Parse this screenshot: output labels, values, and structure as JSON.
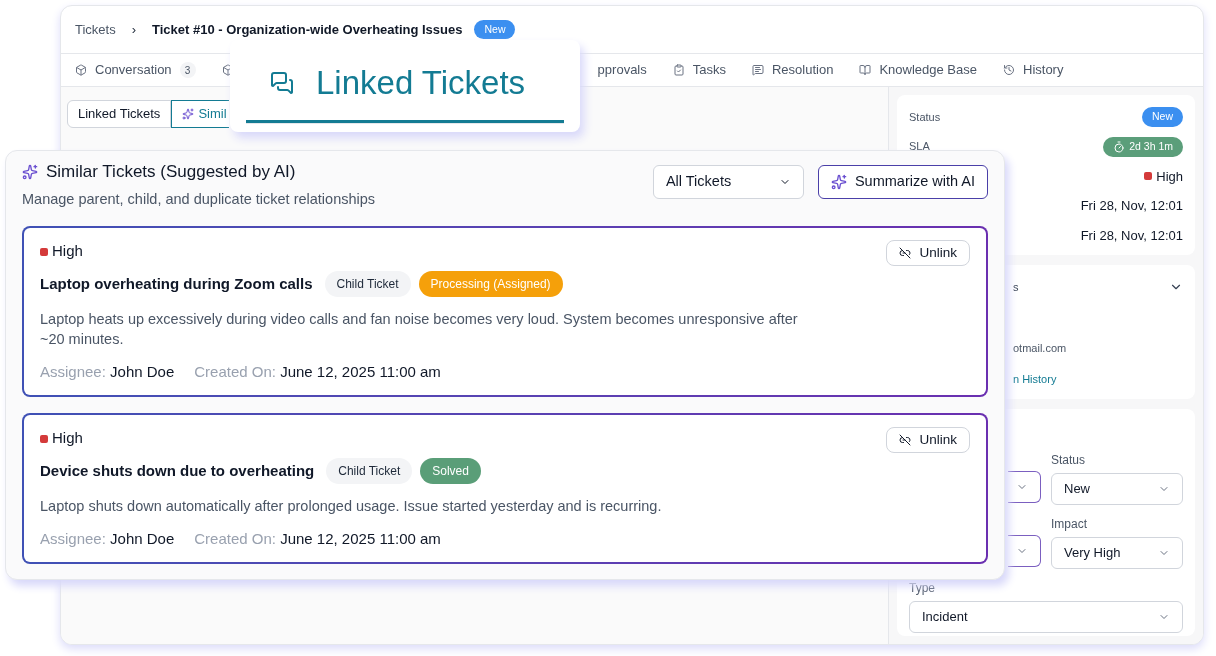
{
  "breadcrumb": {
    "parent": "Tickets",
    "separator": "›",
    "current": "Ticket #10 - Organization-wide Overheating Issues",
    "badge": "New"
  },
  "tabs": [
    {
      "kind": "cube",
      "label": "Conversation",
      "count": "3",
      "selected": false
    },
    {
      "kind": "cube",
      "selected": false
    },
    {
      "kind": "none",
      "label": "pprovals",
      "selected": false
    },
    {
      "kind": "tasks",
      "label": "Tasks",
      "selected": false
    },
    {
      "kind": "resolution",
      "label": "Resolution",
      "selected": false
    },
    {
      "kind": "book",
      "label": "Knowledge Base",
      "selected": false
    },
    {
      "kind": "history",
      "label": "History",
      "selected": false
    }
  ],
  "subtabs": [
    {
      "label": "Linked Tickets",
      "selected": false
    },
    {
      "label": "Simil",
      "selected": true
    }
  ],
  "callout": {
    "title": "Linked Tickets"
  },
  "details": {
    "status_label": "Status",
    "status": "New",
    "sla_label": "SLA",
    "sla": "2d 3h 1m",
    "priority": "High",
    "dates": [
      "Fri 28, Nov, 12:01",
      "Fri 28, Nov, 12:01"
    ]
  },
  "requester": {
    "heading": "s",
    "email": "otmail.com",
    "link": "n History"
  },
  "properties": [
    {
      "kind": "select"
    },
    {
      "kind": "select",
      "label": "Status",
      "value": "New"
    },
    {
      "kind": "select"
    },
    {
      "kind": "select",
      "label": "Impact",
      "value": "Very High"
    },
    {
      "kind": "wide",
      "label": "Type",
      "value": "Incident"
    }
  ],
  "similar": {
    "title": "Similar Tickets (Suggested by AI)",
    "subtitle": "Manage parent, child, and duplicate ticket relationships",
    "filter": "All Tickets",
    "summarize": "Summarize with AI",
    "tickets": [
      {
        "priority": "High",
        "title": "Laptop overheating during Zoom calls",
        "relation": "Child Ticket",
        "status": {
          "label": "Processing (Assigned)",
          "color": "#f5a00a"
        },
        "description": "Laptop heats up excessively during video calls and fan noise becomes very loud. System becomes unresponsive after ~20 minutes.",
        "assignee_label": "Assignee:",
        "assignee": "John Doe",
        "created_label": "Created On:",
        "created": "June 12, 2025 11:00 am",
        "action": "Unlink"
      },
      {
        "priority": "High",
        "title": "Device shuts down due to overheating",
        "relation": "Child Ticket",
        "status": {
          "label": "Solved",
          "color": "#5a9e78"
        },
        "description": "Laptop shuts down automatically after prolonged usage. Issue started yesterday and is recurring.",
        "assignee_label": "Assignee:",
        "assignee": "John Doe",
        "created_label": "Created On:",
        "created": "June 12, 2025 11:00 am",
        "action": "Unlink"
      }
    ]
  }
}
